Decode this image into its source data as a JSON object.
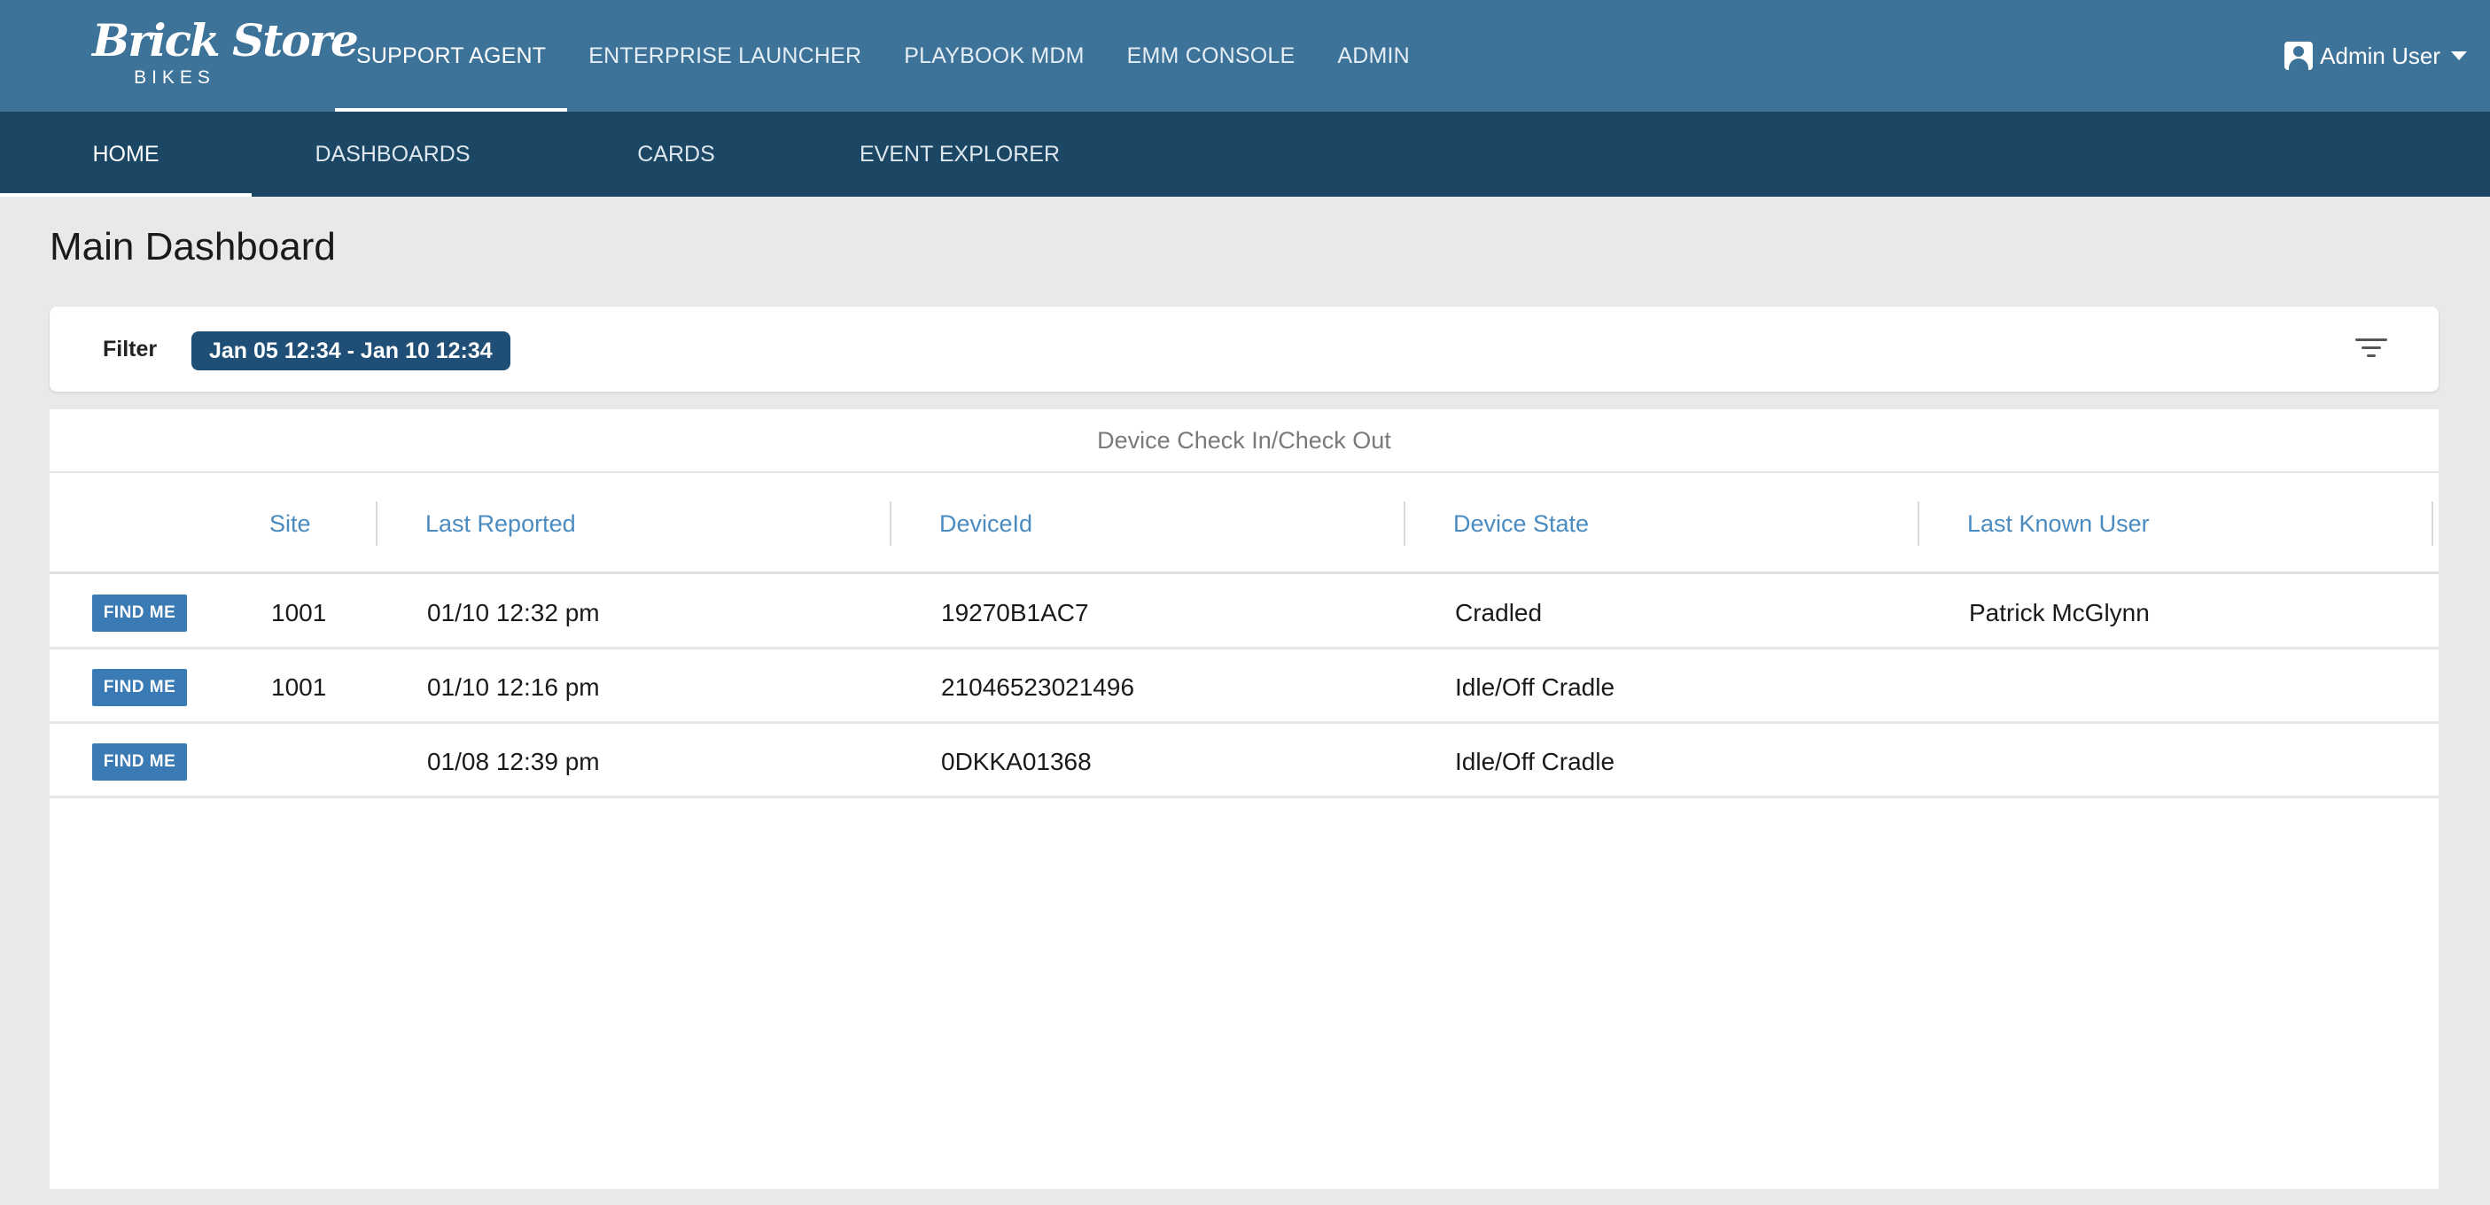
{
  "brand": {
    "script": "Brick Store",
    "sub": "BIKES"
  },
  "top_nav": [
    "SUPPORT AGENT",
    "ENTERPRISE LAUNCHER",
    "PLAYBOOK MDM",
    "EMM CONSOLE",
    "ADMIN"
  ],
  "user": {
    "name": "Admin User"
  },
  "sub_nav": [
    "HOME",
    "DASHBOARDS",
    "CARDS",
    "EVENT EXPLORER"
  ],
  "page": {
    "title": "Main Dashboard"
  },
  "filter": {
    "label": "Filter",
    "range": "Jan 05 12:34 - Jan 10 12:34"
  },
  "table": {
    "title": "Device Check In/Check Out",
    "columns": [
      "Site",
      "Last Reported",
      "DeviceId",
      "Device State",
      "Last Known User"
    ],
    "rows": [
      {
        "action": "FIND ME",
        "site": "1001",
        "last_reported": "01/10 12:32 pm",
        "device_id": "19270B1AC7",
        "state": "Cradled",
        "user": "Patrick McGlynn"
      },
      {
        "action": "FIND ME",
        "site": "1001",
        "last_reported": "01/10 12:16 pm",
        "device_id": "21046523021496",
        "state": "Idle/Off Cradle",
        "user": ""
      },
      {
        "action": "FIND ME",
        "site": "",
        "last_reported": "01/08 12:39 pm",
        "device_id": "0DKKA01368",
        "state": "Idle/Off Cradle",
        "user": ""
      }
    ]
  },
  "icons": {
    "user": "account-box-icon",
    "caret": "caret-down-icon",
    "filter": "filter-list-icon"
  }
}
